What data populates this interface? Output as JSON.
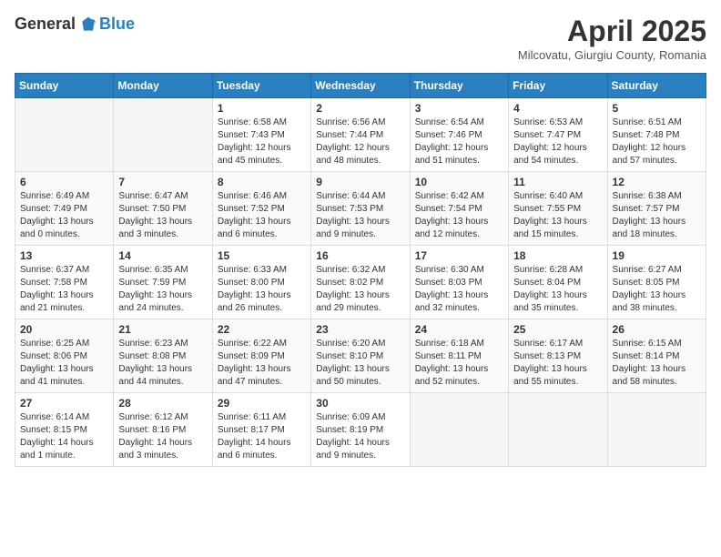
{
  "header": {
    "logo_general": "General",
    "logo_blue": "Blue",
    "title": "April 2025",
    "location": "Milcovatu, Giurgiu County, Romania"
  },
  "days_of_week": [
    "Sunday",
    "Monday",
    "Tuesday",
    "Wednesday",
    "Thursday",
    "Friday",
    "Saturday"
  ],
  "weeks": [
    [
      null,
      null,
      {
        "day": 1,
        "sunrise": "6:58 AM",
        "sunset": "7:43 PM",
        "daylight": "12 hours and 45 minutes."
      },
      {
        "day": 2,
        "sunrise": "6:56 AM",
        "sunset": "7:44 PM",
        "daylight": "12 hours and 48 minutes."
      },
      {
        "day": 3,
        "sunrise": "6:54 AM",
        "sunset": "7:46 PM",
        "daylight": "12 hours and 51 minutes."
      },
      {
        "day": 4,
        "sunrise": "6:53 AM",
        "sunset": "7:47 PM",
        "daylight": "12 hours and 54 minutes."
      },
      {
        "day": 5,
        "sunrise": "6:51 AM",
        "sunset": "7:48 PM",
        "daylight": "12 hours and 57 minutes."
      }
    ],
    [
      {
        "day": 6,
        "sunrise": "6:49 AM",
        "sunset": "7:49 PM",
        "daylight": "13 hours and 0 minutes."
      },
      {
        "day": 7,
        "sunrise": "6:47 AM",
        "sunset": "7:50 PM",
        "daylight": "13 hours and 3 minutes."
      },
      {
        "day": 8,
        "sunrise": "6:46 AM",
        "sunset": "7:52 PM",
        "daylight": "13 hours and 6 minutes."
      },
      {
        "day": 9,
        "sunrise": "6:44 AM",
        "sunset": "7:53 PM",
        "daylight": "13 hours and 9 minutes."
      },
      {
        "day": 10,
        "sunrise": "6:42 AM",
        "sunset": "7:54 PM",
        "daylight": "13 hours and 12 minutes."
      },
      {
        "day": 11,
        "sunrise": "6:40 AM",
        "sunset": "7:55 PM",
        "daylight": "13 hours and 15 minutes."
      },
      {
        "day": 12,
        "sunrise": "6:38 AM",
        "sunset": "7:57 PM",
        "daylight": "13 hours and 18 minutes."
      }
    ],
    [
      {
        "day": 13,
        "sunrise": "6:37 AM",
        "sunset": "7:58 PM",
        "daylight": "13 hours and 21 minutes."
      },
      {
        "day": 14,
        "sunrise": "6:35 AM",
        "sunset": "7:59 PM",
        "daylight": "13 hours and 24 minutes."
      },
      {
        "day": 15,
        "sunrise": "6:33 AM",
        "sunset": "8:00 PM",
        "daylight": "13 hours and 26 minutes."
      },
      {
        "day": 16,
        "sunrise": "6:32 AM",
        "sunset": "8:02 PM",
        "daylight": "13 hours and 29 minutes."
      },
      {
        "day": 17,
        "sunrise": "6:30 AM",
        "sunset": "8:03 PM",
        "daylight": "13 hours and 32 minutes."
      },
      {
        "day": 18,
        "sunrise": "6:28 AM",
        "sunset": "8:04 PM",
        "daylight": "13 hours and 35 minutes."
      },
      {
        "day": 19,
        "sunrise": "6:27 AM",
        "sunset": "8:05 PM",
        "daylight": "13 hours and 38 minutes."
      }
    ],
    [
      {
        "day": 20,
        "sunrise": "6:25 AM",
        "sunset": "8:06 PM",
        "daylight": "13 hours and 41 minutes."
      },
      {
        "day": 21,
        "sunrise": "6:23 AM",
        "sunset": "8:08 PM",
        "daylight": "13 hours and 44 minutes."
      },
      {
        "day": 22,
        "sunrise": "6:22 AM",
        "sunset": "8:09 PM",
        "daylight": "13 hours and 47 minutes."
      },
      {
        "day": 23,
        "sunrise": "6:20 AM",
        "sunset": "8:10 PM",
        "daylight": "13 hours and 50 minutes."
      },
      {
        "day": 24,
        "sunrise": "6:18 AM",
        "sunset": "8:11 PM",
        "daylight": "13 hours and 52 minutes."
      },
      {
        "day": 25,
        "sunrise": "6:17 AM",
        "sunset": "8:13 PM",
        "daylight": "13 hours and 55 minutes."
      },
      {
        "day": 26,
        "sunrise": "6:15 AM",
        "sunset": "8:14 PM",
        "daylight": "13 hours and 58 minutes."
      }
    ],
    [
      {
        "day": 27,
        "sunrise": "6:14 AM",
        "sunset": "8:15 PM",
        "daylight": "14 hours and 1 minute."
      },
      {
        "day": 28,
        "sunrise": "6:12 AM",
        "sunset": "8:16 PM",
        "daylight": "14 hours and 3 minutes."
      },
      {
        "day": 29,
        "sunrise": "6:11 AM",
        "sunset": "8:17 PM",
        "daylight": "14 hours and 6 minutes."
      },
      {
        "day": 30,
        "sunrise": "6:09 AM",
        "sunset": "8:19 PM",
        "daylight": "14 hours and 9 minutes."
      },
      null,
      null,
      null
    ]
  ],
  "labels": {
    "sunrise": "Sunrise:",
    "sunset": "Sunset:",
    "daylight": "Daylight:"
  }
}
